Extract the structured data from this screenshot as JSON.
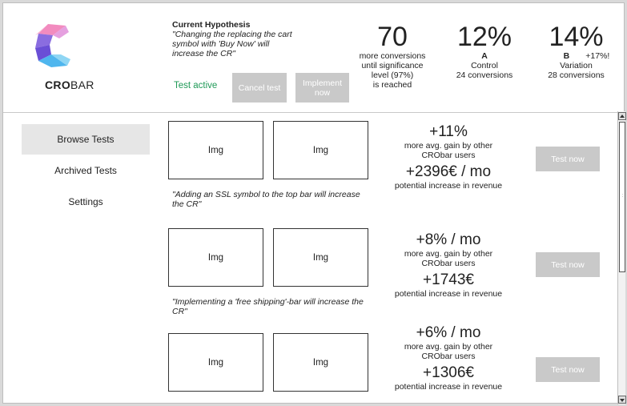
{
  "brand": {
    "prefix": "CRO",
    "suffix": "BAR"
  },
  "hypothesis": {
    "title": "Current Hypothesis",
    "text": "\"Changing the replacing the cart symbol with 'Buy Now' will increase the CR\"",
    "status": "Test active",
    "cancel_label": "Cancel test",
    "implement_label": "Implement now"
  },
  "stats": {
    "conversions": {
      "value": "70",
      "line1": "more conversions",
      "line2": "until significance",
      "line3": "level (97%)",
      "line4": "is reached"
    },
    "control": {
      "value": "12%",
      "letter": "A",
      "label": "Control",
      "detail": "24 conversions"
    },
    "variation": {
      "value": "14%",
      "letter": "B",
      "uplift": "+17%!",
      "label": "Variation",
      "detail": "28 conversions"
    }
  },
  "sidebar": {
    "items": [
      {
        "label": "Browse Tests"
      },
      {
        "label": "Archived Tests"
      },
      {
        "label": "Settings"
      }
    ]
  },
  "tests": [
    {
      "img_a": "Img",
      "img_b": "Img",
      "quote": "\"Adding an SSL symbol to the top bar will increase the CR\"",
      "gain": "+11%",
      "gain_desc1": "more avg. gain by other",
      "gain_desc2": "CRObar users",
      "revenue": "+2396€ / mo",
      "revenue_desc": "potential increase in revenue",
      "button": "Test now"
    },
    {
      "img_a": "Img",
      "img_b": "Img",
      "quote": "\"Implementing a 'free shipping'-bar will increase the CR\"",
      "gain": "+8% / mo",
      "gain_desc1": "more avg. gain by other",
      "gain_desc2": "CRObar users",
      "revenue": "+1743€",
      "revenue_desc": "potential increase in revenue",
      "button": "Test now"
    },
    {
      "img_a": "Img",
      "img_b": "Img",
      "quote": "",
      "gain": "+6% / mo",
      "gain_desc1": "more avg. gain by other",
      "gain_desc2": "CRObar users",
      "revenue": "+1306€",
      "revenue_desc": "potential increase in revenue",
      "button": "Test now"
    }
  ]
}
